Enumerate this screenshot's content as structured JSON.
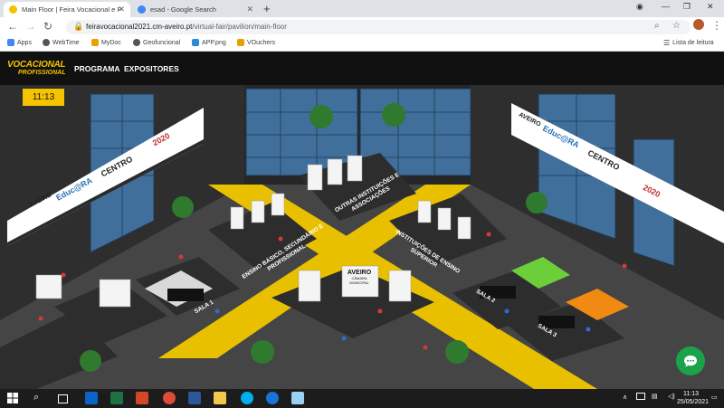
{
  "browser": {
    "tabs": [
      {
        "title": "Main Floor | Feira Vocacional e P",
        "active": true,
        "favicon_color": "#f2c200"
      },
      {
        "title": "esad - Google Search",
        "active": false,
        "favicon_color": "#4285f4"
      }
    ],
    "url_domain": "feiravocacional2021.cm-aveiro.pt",
    "url_path": "/virtual-fair/pavilion/main-floor",
    "bookmarks": [
      {
        "label": "Apps",
        "icon_color": "#4285f4"
      },
      {
        "label": "WebTime",
        "icon_color": "#555555"
      },
      {
        "label": "MyDoc",
        "icon_color": "#e8a200"
      },
      {
        "label": "Geofuncional",
        "icon_color": "#555555"
      },
      {
        "label": "APP.png",
        "icon_color": "#2a8cd6"
      },
      {
        "label": "VOuchers",
        "icon_color": "#e8a200"
      }
    ],
    "reading_list": "Lista de leitura"
  },
  "site": {
    "logo_line1": "VOCACIONAL",
    "logo_line2": "PROFISSIONAL",
    "nav": [
      "PROGRAMA",
      "EXPOSITORES"
    ],
    "clock": "11:13"
  },
  "floor": {
    "zones": [
      "OUTRAS INSTITUIÇÕES E ASSOCIAÇÕES",
      "ENSINO BÁSICO, SECUNDÁRIO E PROFISSIONAL",
      "INSTITUIÇÕES DE ENSINO SUPERIOR"
    ],
    "rooms": [
      "SALA 1",
      "SALA 2",
      "SALA 3"
    ],
    "center_sign": {
      "line1": "AVEIRO",
      "line2": "CÂMARA MUNICIPAL"
    },
    "banner_left": [
      "AVEIRO",
      "Educ@RA",
      "CENTRO",
      "2020"
    ],
    "banner_right": [
      "AVEIRO",
      "Educ@RA",
      "CENTRO",
      "2020"
    ]
  },
  "colors": {
    "accent": "#f5c400",
    "floor": "#4a4a4a",
    "room_green": "#6ccf3a",
    "room_orange": "#f08a12",
    "chat": "#1aa34a"
  },
  "taskbar": {
    "time": "11:13",
    "date": "25/05/2021"
  }
}
